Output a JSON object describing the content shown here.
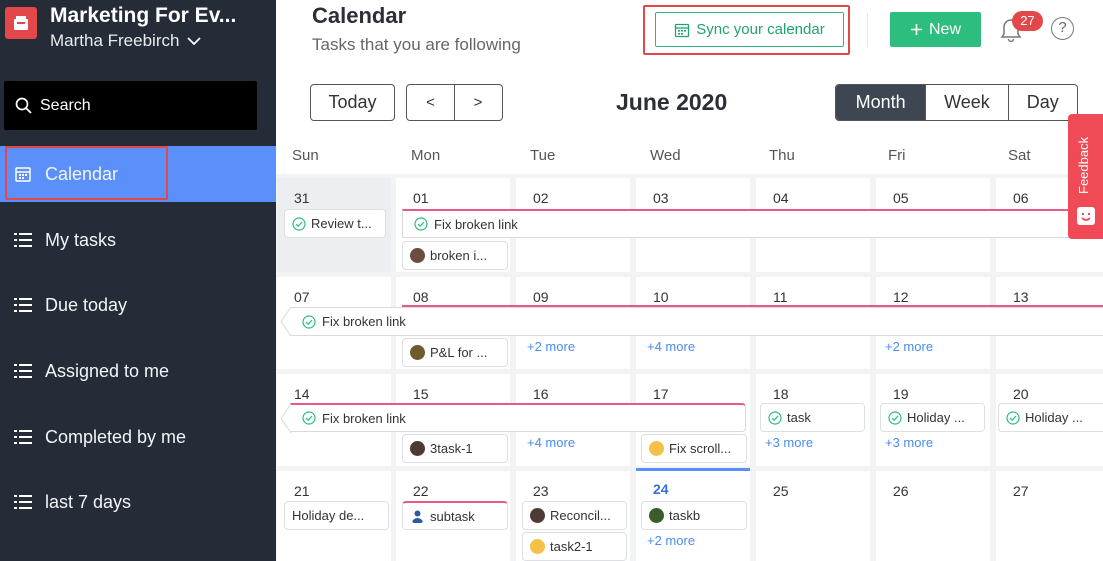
{
  "sidebar": {
    "workspace_name": "Marketing For Ev...",
    "user_name": "Martha Freebirch",
    "search_label": "Search",
    "items": [
      {
        "label": "Calendar",
        "icon": "calendar-icon",
        "active": true
      },
      {
        "label": "My tasks",
        "icon": "list-icon"
      },
      {
        "label": "Due today",
        "icon": "list-icon"
      },
      {
        "label": "Assigned to me",
        "icon": "list-icon"
      },
      {
        "label": "Completed by me",
        "icon": "list-icon"
      },
      {
        "label": "last 7 days",
        "icon": "list-icon"
      }
    ]
  },
  "header": {
    "title": "Calendar",
    "subtitle": "Tasks that you are following",
    "sync_label": "Sync your calendar",
    "new_label": "New",
    "notification_count": "27",
    "help_label": "?"
  },
  "toolbar": {
    "today_label": "Today",
    "prev_label": "<",
    "next_label": ">",
    "month_label": "June 2020",
    "views": [
      "Month",
      "Week",
      "Day"
    ],
    "active_view": "Month"
  },
  "calendar": {
    "weekdays": [
      "Sun",
      "Mon",
      "Tue",
      "Wed",
      "Thu",
      "Fri",
      "Sat"
    ],
    "weeks": [
      [
        "31",
        "01",
        "02",
        "03",
        "04",
        "05",
        "06"
      ],
      [
        "07",
        "08",
        "09",
        "10",
        "11",
        "12",
        "13"
      ],
      [
        "14",
        "15",
        "16",
        "17",
        "18",
        "19",
        "20"
      ],
      [
        "21",
        "22",
        "23",
        "24",
        "25",
        "26",
        "27"
      ]
    ],
    "events": {
      "review": "Review t...",
      "fix_broken_link": "Fix broken link",
      "broken_i": "broken i...",
      "pl_for": "P&L for ...",
      "task_1": "3task-1",
      "fix_scroll": "Fix scroll...",
      "task": "task",
      "holiday_19": "Holiday ...",
      "holiday_20": "Holiday ...",
      "holiday_21": "Holiday de...",
      "subtask": "subtask",
      "reconcil": "Reconcil...",
      "task2_1": "task2-1",
      "taskb": "taskb"
    },
    "more": {
      "w2_tue": "+2 more",
      "w2_wed": "+4 more",
      "w2_fri": "+2 more",
      "w3_tue": "+4 more",
      "w3_thu": "+3 more",
      "w3_fri": "+3 more",
      "w4_wed": "+2 more"
    }
  },
  "feedback": {
    "label": "Feedback"
  },
  "colors": {
    "sidebar_bg": "#252c38",
    "active_nav": "#5b8ff9",
    "green": "#2dbd7e",
    "highlight_red": "#e2484a",
    "link_blue": "#4a8cf0",
    "event_pink": "#e85a86"
  }
}
